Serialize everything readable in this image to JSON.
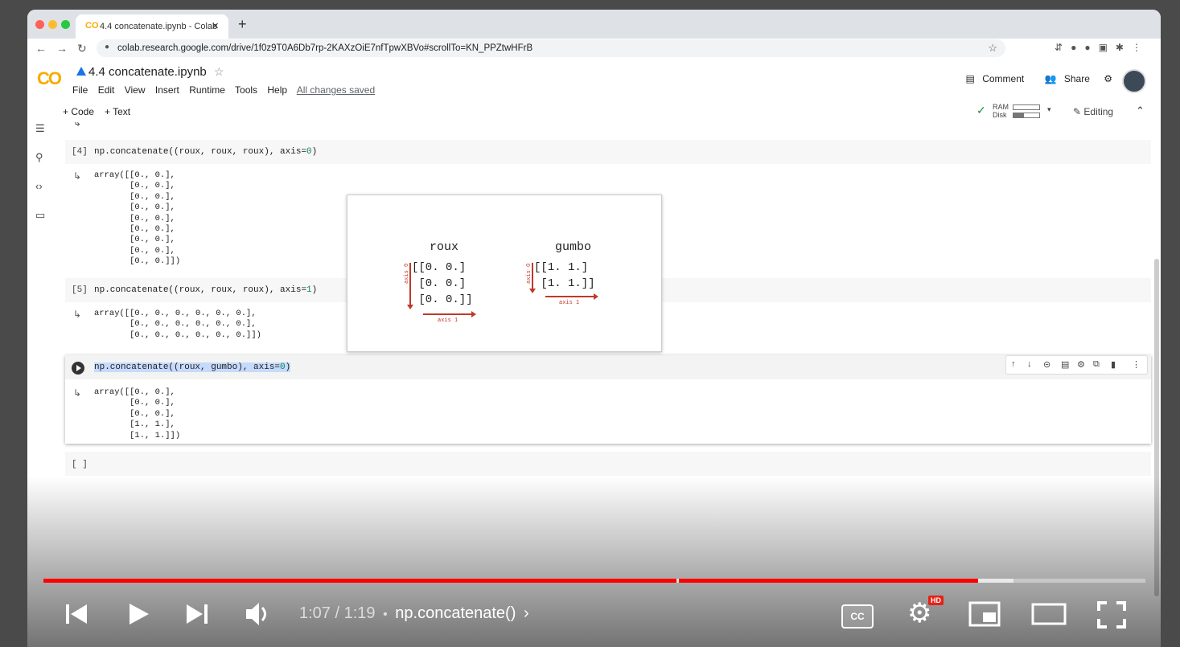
{
  "browser": {
    "tab_title": "4.4 concatenate.ipynb - Colab",
    "tab_logo": "CO",
    "url": "colab.research.google.com/drive/1f0z9T0A6Db7rp-2KAXzOiE7nfTpwXBVo#scrollTo=KN_PPZtwHFrB"
  },
  "colab": {
    "logo": "CO",
    "notebook_name": "4.4 concatenate.ipynb",
    "menu": [
      "File",
      "Edit",
      "View",
      "Insert",
      "Runtime",
      "Tools",
      "Help"
    ],
    "saved_status": "All changes saved",
    "comment_label": "Comment",
    "share_label": "Share",
    "add_code_label": "+ Code",
    "add_text_label": "+ Text",
    "ram_label": "RAM",
    "disk_label": "Disk",
    "editing_label": "Editing"
  },
  "cells": [
    {
      "prompt": "[4]",
      "code_text": "np.concatenate((roux, roux, roux), axis=",
      "code_num": "0",
      "code_end": ")",
      "output": "array([[0., 0.],\n       [0., 0.],\n       [0., 0.],\n       [0., 0.],\n       [0., 0.],\n       [0., 0.],\n       [0., 0.],\n       [0., 0.],\n       [0., 0.]])"
    },
    {
      "prompt": "[5]",
      "code_text": "np.concatenate((roux, roux, roux), axis=",
      "code_num": "1",
      "code_end": ")",
      "output": "array([[0., 0., 0., 0., 0., 0.],\n       [0., 0., 0., 0., 0., 0.],\n       [0., 0., 0., 0., 0., 0.]])"
    },
    {
      "prompt": "",
      "code_text": "np.concatenate((roux, gumbo), axis=",
      "code_num": "0",
      "code_end": ")",
      "output": "array([[0., 0.],\n       [0., 0.],\n       [0., 0.],\n       [1., 1.],\n       [1., 1.]])"
    },
    {
      "prompt": "[ ]"
    }
  ],
  "figure": {
    "left_title": "roux",
    "left_matrix": "[[0. 0.]\n [0. 0.]\n [0. 0.]]",
    "right_title": "gumbo",
    "right_matrix": "[[1. 1.]\n [1. 1.]]",
    "axis0_label": "axis 0",
    "axis1_label": "axis 1",
    "arrow_color": "#c0392b"
  },
  "video": {
    "time": "1:07 / 1:19",
    "separator": "•",
    "chapter": "np.concatenate()",
    "hd_badge": "HD",
    "cc_label": "CC",
    "played_fraction": 0.848,
    "buffered_fraction": 0.88
  }
}
